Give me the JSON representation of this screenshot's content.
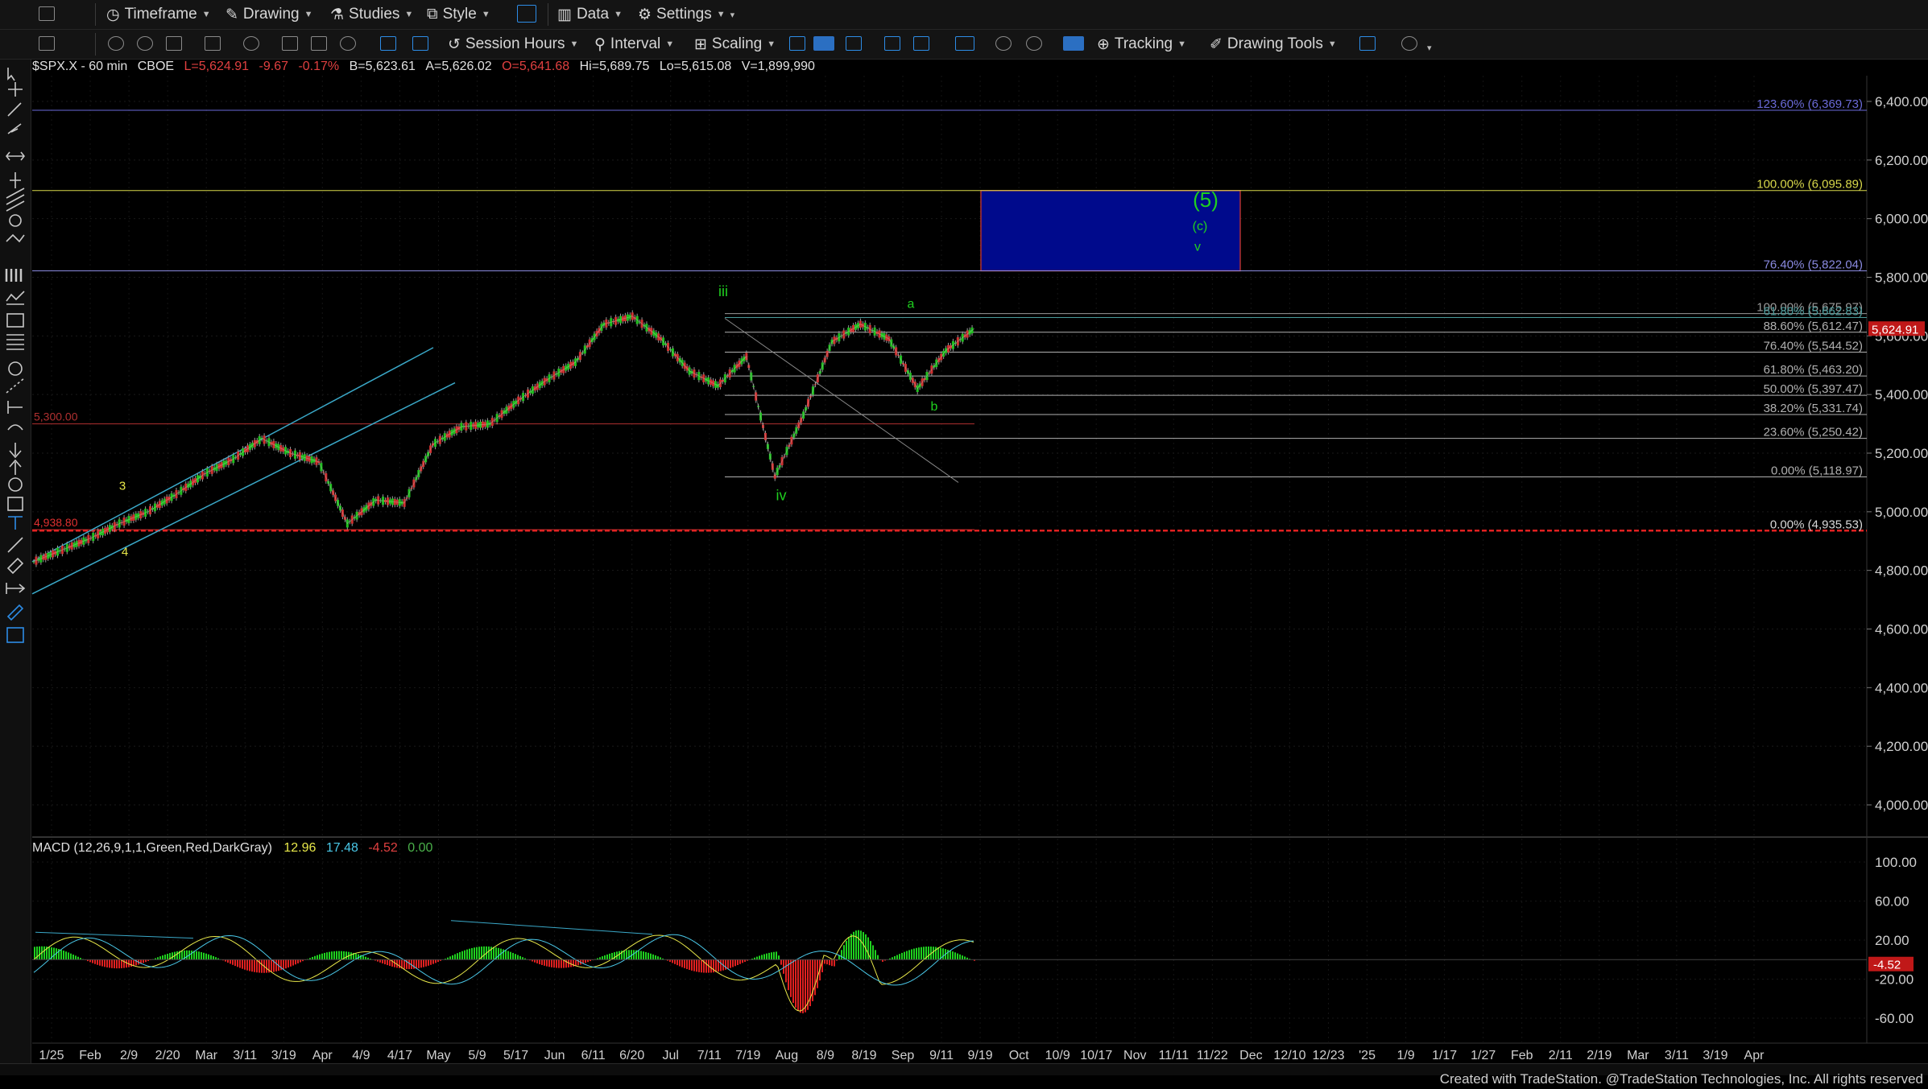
{
  "toolbar1": {
    "timeframe": "Timeframe",
    "drawing": "Drawing",
    "studies": "Studies",
    "style": "Style",
    "data": "Data",
    "settings": "Settings"
  },
  "toolbar2": {
    "session_hours": "Session Hours",
    "interval": "Interval",
    "scaling": "Scaling",
    "tracking": "Tracking",
    "drawing_tools": "Drawing Tools"
  },
  "symbol_header": {
    "symbol": "$SPX.X - 60 min",
    "exchange": "CBOE",
    "last": "L=5,624.91",
    "change": "-9.67",
    "change_pct": "-0.17%",
    "bid": "B=5,623.61",
    "ask": "A=5,626.02",
    "open": "O=5,641.68",
    "high": "Hi=5,689.75",
    "low": "Lo=5,615.08",
    "volume": "V=1,899,990"
  },
  "price_axis": {
    "labels": [
      "6,400.00",
      "6,200.00",
      "6,000.00",
      "5,800.00",
      "5,600.00",
      "5,400.00",
      "5,200.00",
      "5,000.00",
      "4,800.00",
      "4,600.00",
      "4,400.00",
      "4,200.00",
      "4,000.00"
    ],
    "values": [
      6400,
      6200,
      6000,
      5800,
      5600,
      5400,
      5200,
      5000,
      4800,
      4600,
      4400,
      4200,
      4000
    ],
    "last_price_tag": "5,624.91"
  },
  "date_axis": {
    "labels": [
      "1/25",
      "Feb",
      "2/9",
      "2/20",
      "Mar",
      "3/11",
      "3/19",
      "Apr",
      "4/9",
      "4/17",
      "May",
      "5/9",
      "5/17",
      "Jun",
      "6/11",
      "6/20",
      "Jul",
      "7/11",
      "7/19",
      "Aug",
      "8/9",
      "8/19",
      "Sep",
      "9/11",
      "9/19",
      "Oct",
      "10/9",
      "10/17",
      "Nov",
      "11/11",
      "11/22",
      "Dec",
      "12/10",
      "12/23",
      "'25",
      "1/9",
      "1/17",
      "1/27",
      "Feb",
      "2/11",
      "2/19",
      "Mar",
      "3/11",
      "3/19",
      "Apr"
    ]
  },
  "fib_levels": [
    {
      "label": "123.60% (6,369.73)",
      "price": 6369.73,
      "color": "#6a6ad8"
    },
    {
      "label": "100.00% (6,095.89)",
      "price": 6095.89,
      "color": "#d8d84a"
    },
    {
      "label": "76.40% (5,822.04)",
      "price": 5822.04,
      "color": "#8a8ae0"
    },
    {
      "label": "100.00% (5,675.97)",
      "price": 5675.97,
      "color": "#9a9a9a"
    },
    {
      "label": "61.80% (5,662.83)",
      "price": 5662.83,
      "color": "#4a9a9a"
    },
    {
      "label": "88.60% (5,612.47)",
      "price": 5612.47,
      "color": "#b0b0b0"
    },
    {
      "label": "76.40% (5,544.52)",
      "price": 5544.52,
      "color": "#b0b0b0"
    },
    {
      "label": "61.80% (5,463.20)",
      "price": 5463.2,
      "color": "#b0b0b0"
    },
    {
      "label": "50.00% (5,397.47)",
      "price": 5397.47,
      "color": "#b0b0b0"
    },
    {
      "label": "38.20% (5,331.74)",
      "price": 5331.74,
      "color": "#b0b0b0"
    },
    {
      "label": "23.60% (5,250.42)",
      "price": 5250.42,
      "color": "#b0b0b0"
    },
    {
      "label": "0.00% (5,118.97)",
      "price": 5118.97,
      "color": "#b0b0b0"
    },
    {
      "label": "0.00% (4,935.53)",
      "price": 4935.53,
      "color": "#d8d8d8"
    }
  ],
  "left_levels": [
    {
      "label": "5,300.00",
      "price": 5300,
      "color": "#b03030"
    },
    {
      "label": "4,938.80",
      "price": 4938.8,
      "color": "#e03030"
    }
  ],
  "target_box": {
    "top": 6095.89,
    "bottom": 5822.04,
    "fill": "#000a8c",
    "border": "#b03030"
  },
  "wave_labels": {
    "five": "(5)",
    "c": "(c)",
    "v": "v",
    "iii": "iii",
    "iv": "iv",
    "a": "a",
    "b": "b",
    "three": "3",
    "four": "4"
  },
  "macd": {
    "label": "MACD (12,26,9,1,1,Green,Red,DarkGray)",
    "v1": "12.96",
    "v2": "17.48",
    "v3": "-4.52",
    "v4": "0.00",
    "axis_labels": [
      "100.00",
      "60.00",
      "20.00",
      "-20.00",
      "-60.00"
    ],
    "axis_values": [
      100,
      60,
      20,
      -20,
      -60
    ],
    "last_tag": "-4.52"
  },
  "chart_data": {
    "type": "line",
    "title": "$SPX.X - 60 min",
    "xlabel": "",
    "ylabel": "",
    "ylim": [
      3950,
      6460
    ],
    "series": [
      {
        "name": "$SPX.X",
        "x": [
          "1/22",
          "1/25",
          "Feb",
          "2/9",
          "2/20",
          "Mar",
          "3/11",
          "3/19",
          "3/28",
          "Apr",
          "4/9",
          "4/19",
          "4/24",
          "May",
          "5/9",
          "5/17",
          "Jun",
          "6/11",
          "6/20",
          "Jul",
          "7/11",
          "7/16",
          "7/19",
          "7/24",
          "7/26",
          "8/1",
          "8/5",
          "8/9",
          "8/19",
          "8/23",
          "Sep",
          "9/6",
          "9/11",
          "9/19"
        ],
        "values": [
          4830,
          4870,
          4910,
          4960,
          5000,
          5060,
          5130,
          5180,
          5250,
          5200,
          5170,
          4960,
          5040,
          5030,
          5230,
          5290,
          5300,
          5380,
          5450,
          5510,
          5640,
          5667,
          5590,
          5480,
          5430,
          5530,
          5120,
          5330,
          5580,
          5640,
          5590,
          5420,
          5550,
          5625
        ]
      }
    ],
    "grid": true,
    "legend": "none"
  },
  "footer": "Created with TradeStation. @TradeStation Technologies, Inc. All rights reserved"
}
